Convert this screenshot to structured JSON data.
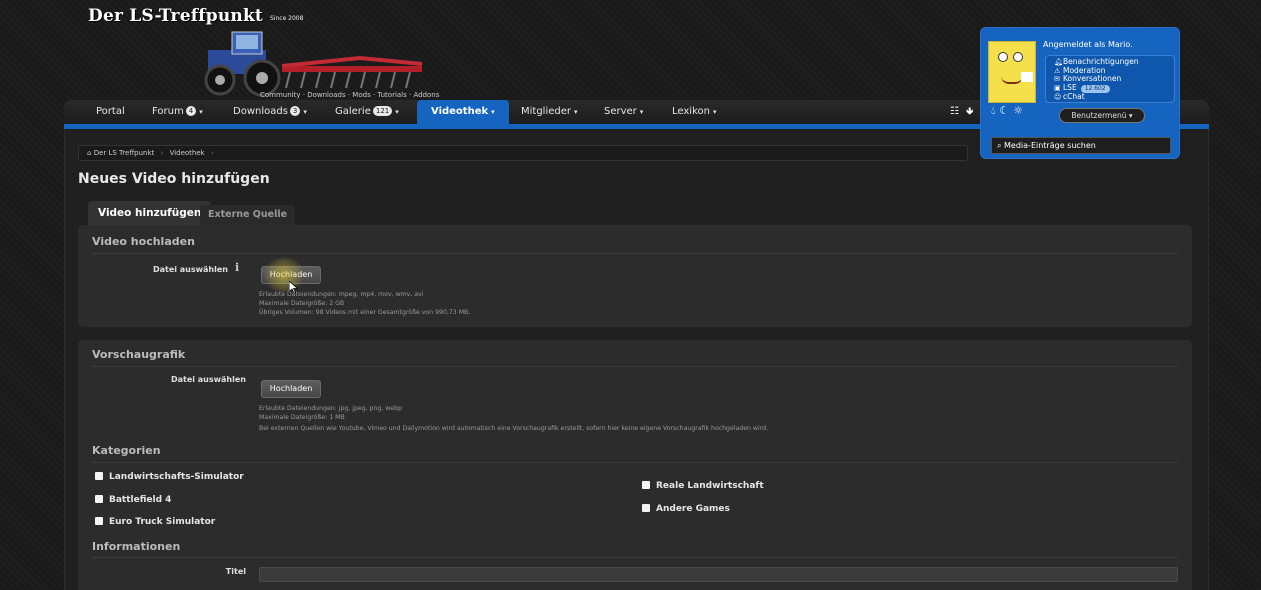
{
  "header": {
    "site_title": "Der LS-Treffpunkt",
    "since": "Since 2008",
    "subnav": "Community · Downloads · Mods · Tutorials · Addons"
  },
  "nav": {
    "items": [
      {
        "label": "Portal",
        "badge": null
      },
      {
        "label": "Forum",
        "badge": "4"
      },
      {
        "label": "Downloads",
        "badge": "3"
      },
      {
        "label": "Galerie",
        "badge": "121"
      },
      {
        "label": "Videothek",
        "badge": null
      },
      {
        "label": "Mitglieder",
        "badge": null
      },
      {
        "label": "Server",
        "badge": null
      },
      {
        "label": "Lexikon",
        "badge": null
      }
    ],
    "active_label": "Videothek",
    "right_icons": [
      "sitemap-icon",
      "arrow-down-icon"
    ]
  },
  "userpanel": {
    "logged_in": "Angemeldet als Mario.",
    "links": [
      "Benachrichtigungen",
      "Moderation",
      "Konversationen",
      "LSE",
      "cChat"
    ],
    "lse_value": "12.602",
    "menu_button": "Benutzermenü",
    "search_label": "Media-Einträge suchen",
    "accent_color": "#1565c0"
  },
  "breadcrumb": [
    "Der LS Treffpunkt",
    "Videothek"
  ],
  "page_title": "Neues Video hinzufügen",
  "tabs": [
    "Video hinzufügen",
    "Externe Quelle"
  ],
  "upload_section": {
    "heading": "Video hochladen",
    "label": "Datei auswählen",
    "button": "Hochladen",
    "hints": [
      "Erlaubte Dateiendungen: mpeg, mp4, mov, wmv, avi",
      "Maximale Dateigröße: 2 GB",
      "Übriges Volumen: 98 Videos mit einer Gesamtgröße von 990,73 MB."
    ]
  },
  "preview_section": {
    "heading": "Vorschaugrafik",
    "label": "Datei auswählen",
    "button": "Hochladen",
    "hints": [
      "Erlaubte Dateiendungen: jpg, jpeg, png, webp",
      "Maximale Dateigröße: 1 MB",
      "Bei externen Quellen wie Youtube, Vimeo und Dailymotion wird automatisch eine Vorschaugrafik erstellt, sofern hier keine eigene Vorschaugrafik hochgeladen wird."
    ]
  },
  "categories": {
    "heading": "Kategorien",
    "left": [
      "Landwirtschafts-Simulator",
      "Battlefield 4",
      "Euro Truck Simulator"
    ],
    "right": [
      "Reale Landwirtschaft",
      "Andere Games"
    ]
  },
  "information": {
    "heading": "Informationen",
    "title_label": "Titel"
  }
}
